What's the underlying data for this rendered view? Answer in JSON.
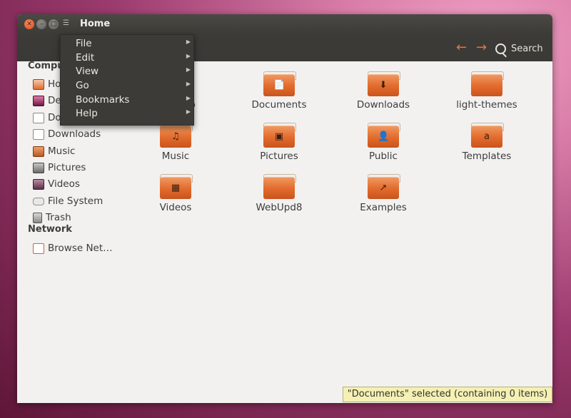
{
  "window": {
    "title": "Home"
  },
  "toolbar": {
    "back_icon": "←",
    "forward_icon": "→",
    "search_label": "Search"
  },
  "sidebar": {
    "computer_heading": "Computer",
    "computer_items": [
      {
        "label": "Home",
        "icon": "home-folder-icon"
      },
      {
        "label": "Desktop",
        "icon": "desktop-icon"
      },
      {
        "label": "Documents",
        "icon": "documents-icon"
      },
      {
        "label": "Downloads",
        "icon": "downloads-icon"
      },
      {
        "label": "Music",
        "icon": "music-icon"
      },
      {
        "label": "Pictures",
        "icon": "pictures-icon"
      },
      {
        "label": "Videos",
        "icon": "videos-icon"
      },
      {
        "label": "File System",
        "icon": "drive-icon"
      },
      {
        "label": "Trash",
        "icon": "trash-icon"
      }
    ],
    "network_heading": "Network",
    "network_items": [
      {
        "label": "Browse Net…",
        "icon": "network-icon"
      }
    ]
  },
  "files": [
    {
      "label": "Desktop",
      "emblem": ""
    },
    {
      "label": "Documents",
      "emblem": "📄"
    },
    {
      "label": "Downloads",
      "emblem": "⬇"
    },
    {
      "label": "light-themes",
      "emblem": ""
    },
    {
      "label": "Music",
      "emblem": "♫"
    },
    {
      "label": "Pictures",
      "emblem": "▣"
    },
    {
      "label": "Public",
      "emblem": "👤"
    },
    {
      "label": "Templates",
      "emblem": "a"
    },
    {
      "label": "Videos",
      "emblem": "▦"
    },
    {
      "label": "WebUpd8",
      "emblem": ""
    },
    {
      "label": "Examples",
      "emblem": "↗"
    }
  ],
  "menu": {
    "items": [
      {
        "label": "File"
      },
      {
        "label": "Edit"
      },
      {
        "label": "View"
      },
      {
        "label": "Go"
      },
      {
        "label": "Bookmarks"
      },
      {
        "label": "Help"
      }
    ]
  },
  "status": {
    "text": "\"Documents\" selected (containing 0 items)"
  },
  "colors": {
    "accent": "#e26a2c",
    "titlebar": "#3c3b37",
    "status_bg": "#f5f0b3"
  }
}
